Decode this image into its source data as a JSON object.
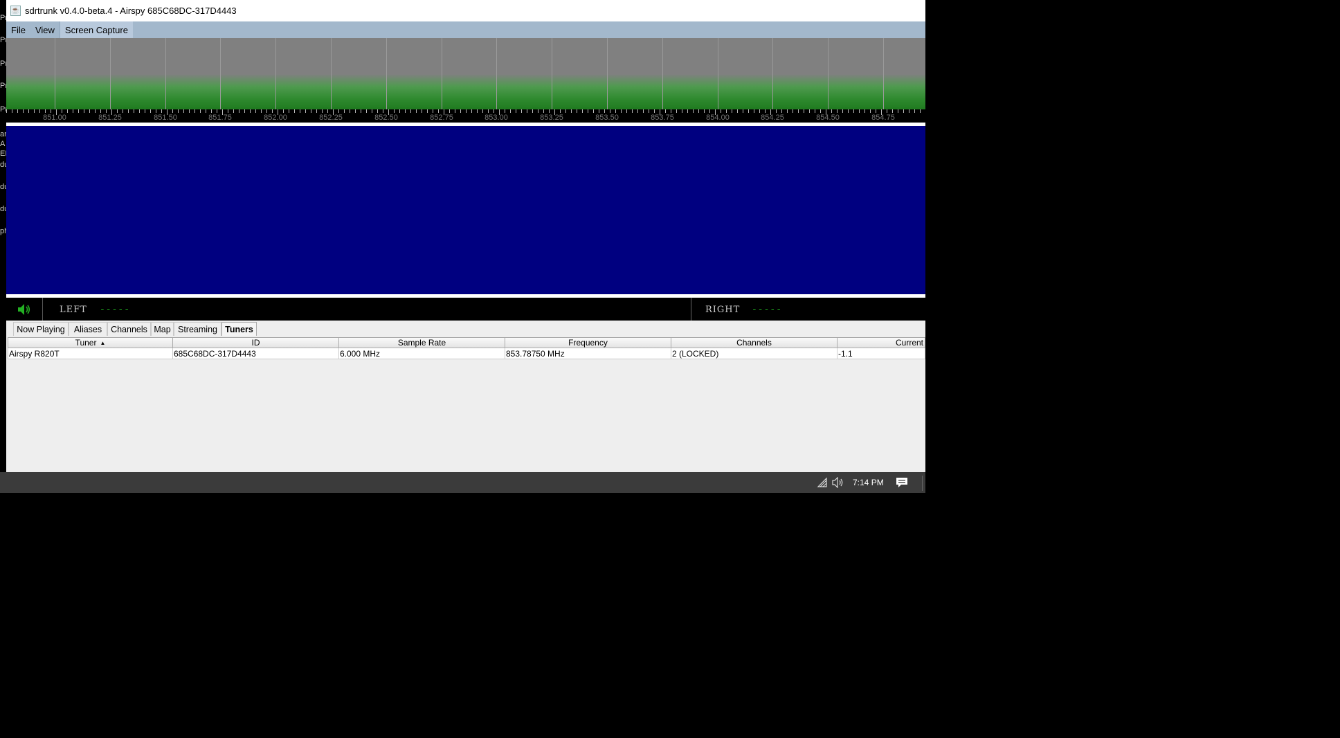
{
  "window": {
    "title": "sdrtrunk v0.4.0-beta.4 - Airspy 685C68DC-317D4443",
    "app_icon": "java-icon"
  },
  "menu": {
    "items": [
      {
        "label": "File"
      },
      {
        "label": "View"
      },
      {
        "label": "Screen Capture"
      }
    ]
  },
  "spectrum": {
    "frequency_labels": [
      "851.00",
      "851.25",
      "851.50",
      "851.75",
      "852.00",
      "852.25",
      "852.50",
      "852.75",
      "853.00",
      "853.25",
      "853.50",
      "853.75",
      "854.00",
      "854.25",
      "854.50",
      "854.75"
    ],
    "colors": {
      "background": "#808080",
      "signal": "#2f8a2f",
      "waterfall": "#000080"
    }
  },
  "audio": {
    "left_label": "LEFT",
    "left_value": "-----",
    "right_label": "RIGHT",
    "right_value": "-----",
    "speaker_icon": "speaker-icon",
    "accent_color": "#23b023"
  },
  "tabs": [
    {
      "label": "Now Playing",
      "selected": false
    },
    {
      "label": "Aliases",
      "selected": false
    },
    {
      "label": "Channels",
      "selected": false
    },
    {
      "label": "Map",
      "selected": false
    },
    {
      "label": "Streaming",
      "selected": false
    },
    {
      "label": "Tuners",
      "selected": true
    }
  ],
  "tuners_table": {
    "columns": [
      "Tuner",
      "ID",
      "Sample Rate",
      "Frequency",
      "Channels",
      "Current"
    ],
    "sorted_column": "Tuner",
    "sort_direction": "ascending",
    "rows": [
      [
        "Airspy R820T",
        "685C68DC-317D4443",
        "6.000 MHz",
        "853.78750 MHz",
        "2 (LOCKED)",
        "-1.1"
      ]
    ]
  },
  "taskbar": {
    "time": "7:14 PM",
    "icons": [
      "network-icon",
      "volume-icon",
      "notification-icon"
    ]
  },
  "background_sliver": [
    "Pr",
    "Pr",
    "Pr",
    "Pr",
    "Pr",
    "ar",
    "A",
    "EN",
    "du",
    "du",
    "du",
    "ph"
  ]
}
